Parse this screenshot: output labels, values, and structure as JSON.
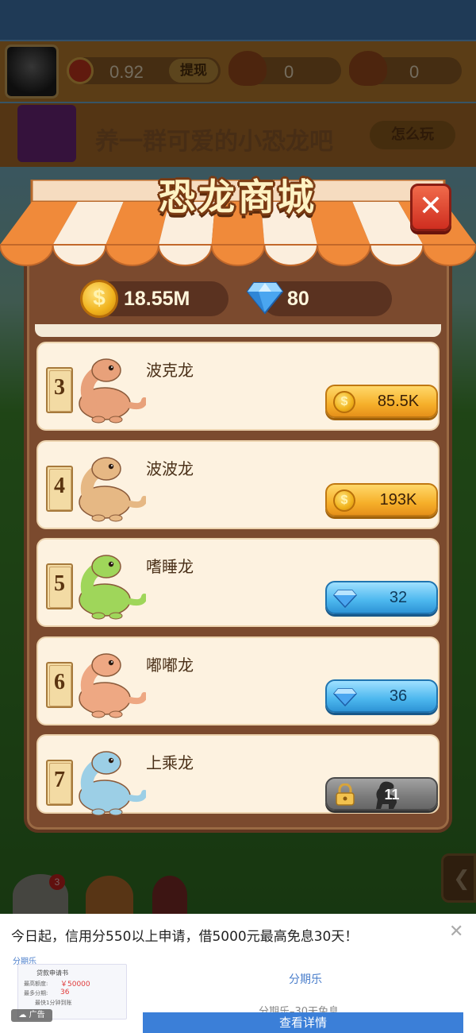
{
  "hud": {
    "balance": "0.92",
    "withdraw_label": "提现",
    "counter_1": "0",
    "counter_2": "0"
  },
  "banner": {
    "text": "养一群可爱的小恐龙吧",
    "how_to_play": "怎么玩"
  },
  "shop": {
    "title": "恐龙商城",
    "close_glyph": "✕",
    "coins": "18.55M",
    "gems": "80",
    "items": [
      {
        "level": "3",
        "name": "波克龙",
        "price": "85.5K",
        "currency": "coin",
        "color": "#e8a17a"
      },
      {
        "level": "4",
        "name": "波波龙",
        "price": "193K",
        "currency": "coin",
        "color": "#e6b884"
      },
      {
        "level": "5",
        "name": "嗜睡龙",
        "price": "32",
        "currency": "gem",
        "color": "#9fd65a"
      },
      {
        "level": "6",
        "name": "嘟嘟龙",
        "price": "36",
        "currency": "gem",
        "color": "#eea883"
      },
      {
        "level": "7",
        "name": "上乘龙",
        "price": "11",
        "currency": "locked",
        "color": "#9ccfe6"
      }
    ]
  },
  "bottom": {
    "egg_badge": "3"
  },
  "ad": {
    "headline": "今日起，信用分550以上申请，借5000元最高免息30天！",
    "close": "✕",
    "brand_small": "分期乐",
    "card_title": "贷款申请书",
    "card_amount_label": "最高额度:",
    "card_amount": "￥50000",
    "card_term_label": "最多分期:",
    "card_term": "36",
    "card_speed": "最快1分钟到账",
    "label": "广告",
    "brand": "分期乐",
    "subtitle": "分期乐–30天免息",
    "cta": "查看详情"
  },
  "colors": {
    "panel": "#7b4a2e",
    "item_bg": "#fdf2e0",
    "gold_button": "#f6b02a",
    "blue_button": "#4cb7ee",
    "close_red": "#cf2e20",
    "ad_cta": "#3b7fd8"
  }
}
